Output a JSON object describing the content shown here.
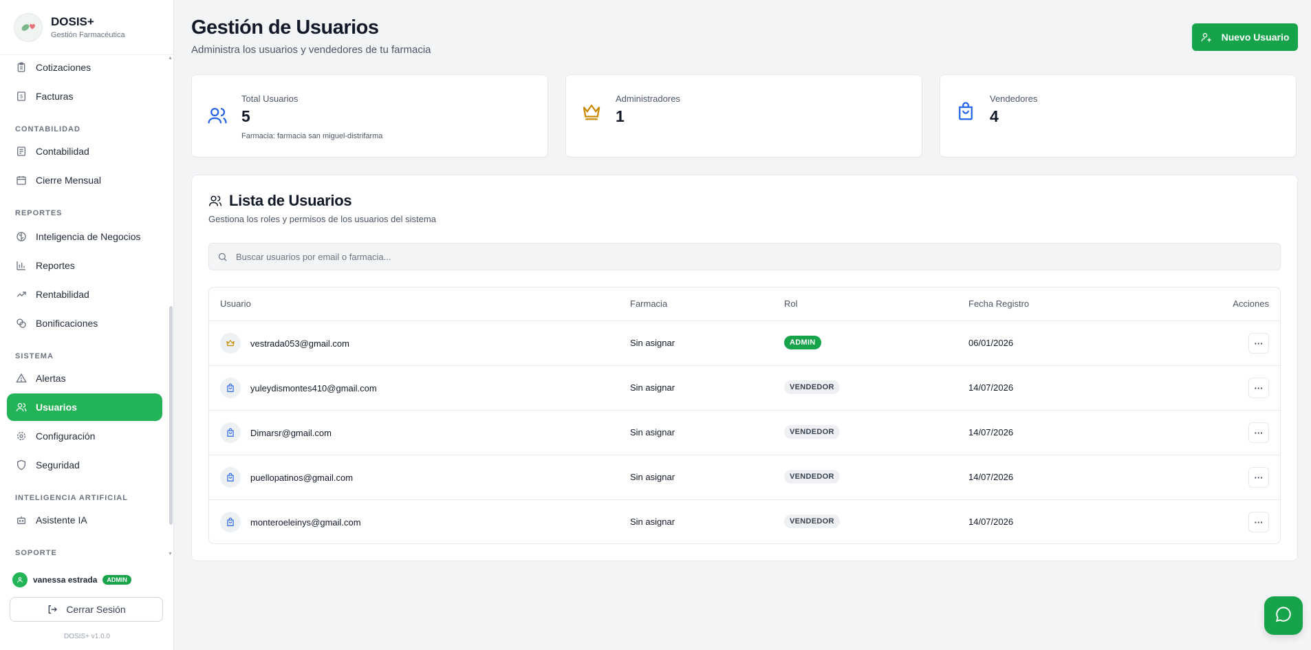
{
  "brand": {
    "title": "DOSIS+",
    "subtitle": "Gestión Farmacéutica"
  },
  "sidebar": {
    "items_top": [
      {
        "label": "Cotizaciones",
        "icon": "clipboard-icon"
      },
      {
        "label": "Facturas",
        "icon": "receipt-icon"
      }
    ],
    "sections": [
      {
        "title": "CONTABILIDAD",
        "items": [
          {
            "label": "Contabilidad",
            "icon": "ledger-icon"
          },
          {
            "label": "Cierre Mensual",
            "icon": "calendar-icon"
          }
        ]
      },
      {
        "title": "REPORTES",
        "items": [
          {
            "label": "Inteligencia de Negocios",
            "icon": "brain-icon"
          },
          {
            "label": "Reportes",
            "icon": "bar-chart-icon"
          },
          {
            "label": "Rentabilidad",
            "icon": "trending-up-icon"
          },
          {
            "label": "Bonificaciones",
            "icon": "coins-icon"
          }
        ]
      },
      {
        "title": "SISTEMA",
        "items": [
          {
            "label": "Alertas",
            "icon": "alert-triangle-icon"
          },
          {
            "label": "Usuarios",
            "icon": "users-icon",
            "active": true
          },
          {
            "label": "Configuración",
            "icon": "gear-icon"
          },
          {
            "label": "Seguridad",
            "icon": "shield-icon"
          }
        ]
      },
      {
        "title": "INTELIGENCIA ARTIFICIAL",
        "items": [
          {
            "label": "Asistente IA",
            "icon": "bot-icon"
          }
        ]
      },
      {
        "title": "SOPORTE",
        "items": []
      }
    ],
    "user": {
      "name": "vanessa estrada",
      "badge": "ADMIN"
    },
    "logout_label": "Cerrar Sesión",
    "version": "DOSIS+ v1.0.0"
  },
  "header": {
    "title": "Gestión de Usuarios",
    "subtitle": "Administra los usuarios y vendedores de tu farmacia",
    "new_user_label": "Nuevo Usuario"
  },
  "stats": {
    "total": {
      "label": "Total Usuarios",
      "value": "5",
      "note": "Farmacia: farmacia san miguel-distrifarma"
    },
    "admins": {
      "label": "Administradores",
      "value": "1"
    },
    "sellers": {
      "label": "Vendedores",
      "value": "4"
    }
  },
  "list": {
    "title": "Lista de Usuarios",
    "subtitle": "Gestiona los roles y permisos de los usuarios del sistema",
    "search_placeholder": "Buscar usuarios por email o farmacia...",
    "columns": {
      "user": "Usuario",
      "pharmacy": "Farmacia",
      "role": "Rol",
      "date": "Fecha Registro",
      "actions": "Acciones"
    },
    "rows": [
      {
        "email": "vestrada053@gmail.com",
        "pharmacy": "Sin asignar",
        "role": "ADMIN",
        "date": "06/01/2026",
        "icon": "crown-icon"
      },
      {
        "email": "yuleydismontes410@gmail.com",
        "pharmacy": "Sin asignar",
        "role": "VENDEDOR",
        "date": "14/07/2026",
        "icon": "shopping-bag-icon"
      },
      {
        "email": "Dimarsr@gmail.com",
        "pharmacy": "Sin asignar",
        "role": "VENDEDOR",
        "date": "14/07/2026",
        "icon": "shopping-bag-icon"
      },
      {
        "email": "puellopatinos@gmail.com",
        "pharmacy": "Sin asignar",
        "role": "VENDEDOR",
        "date": "14/07/2026",
        "icon": "shopping-bag-icon"
      },
      {
        "email": "monteroeleinys@gmail.com",
        "pharmacy": "Sin asignar",
        "role": "VENDEDOR",
        "date": "14/07/2026",
        "icon": "shopping-bag-icon"
      }
    ],
    "actions_glyph": "···"
  },
  "colors": {
    "primary": "#16a34a",
    "active_nav": "#22b457",
    "admin_icon": "#ca8a04",
    "seller_icon": "#2563eb"
  }
}
